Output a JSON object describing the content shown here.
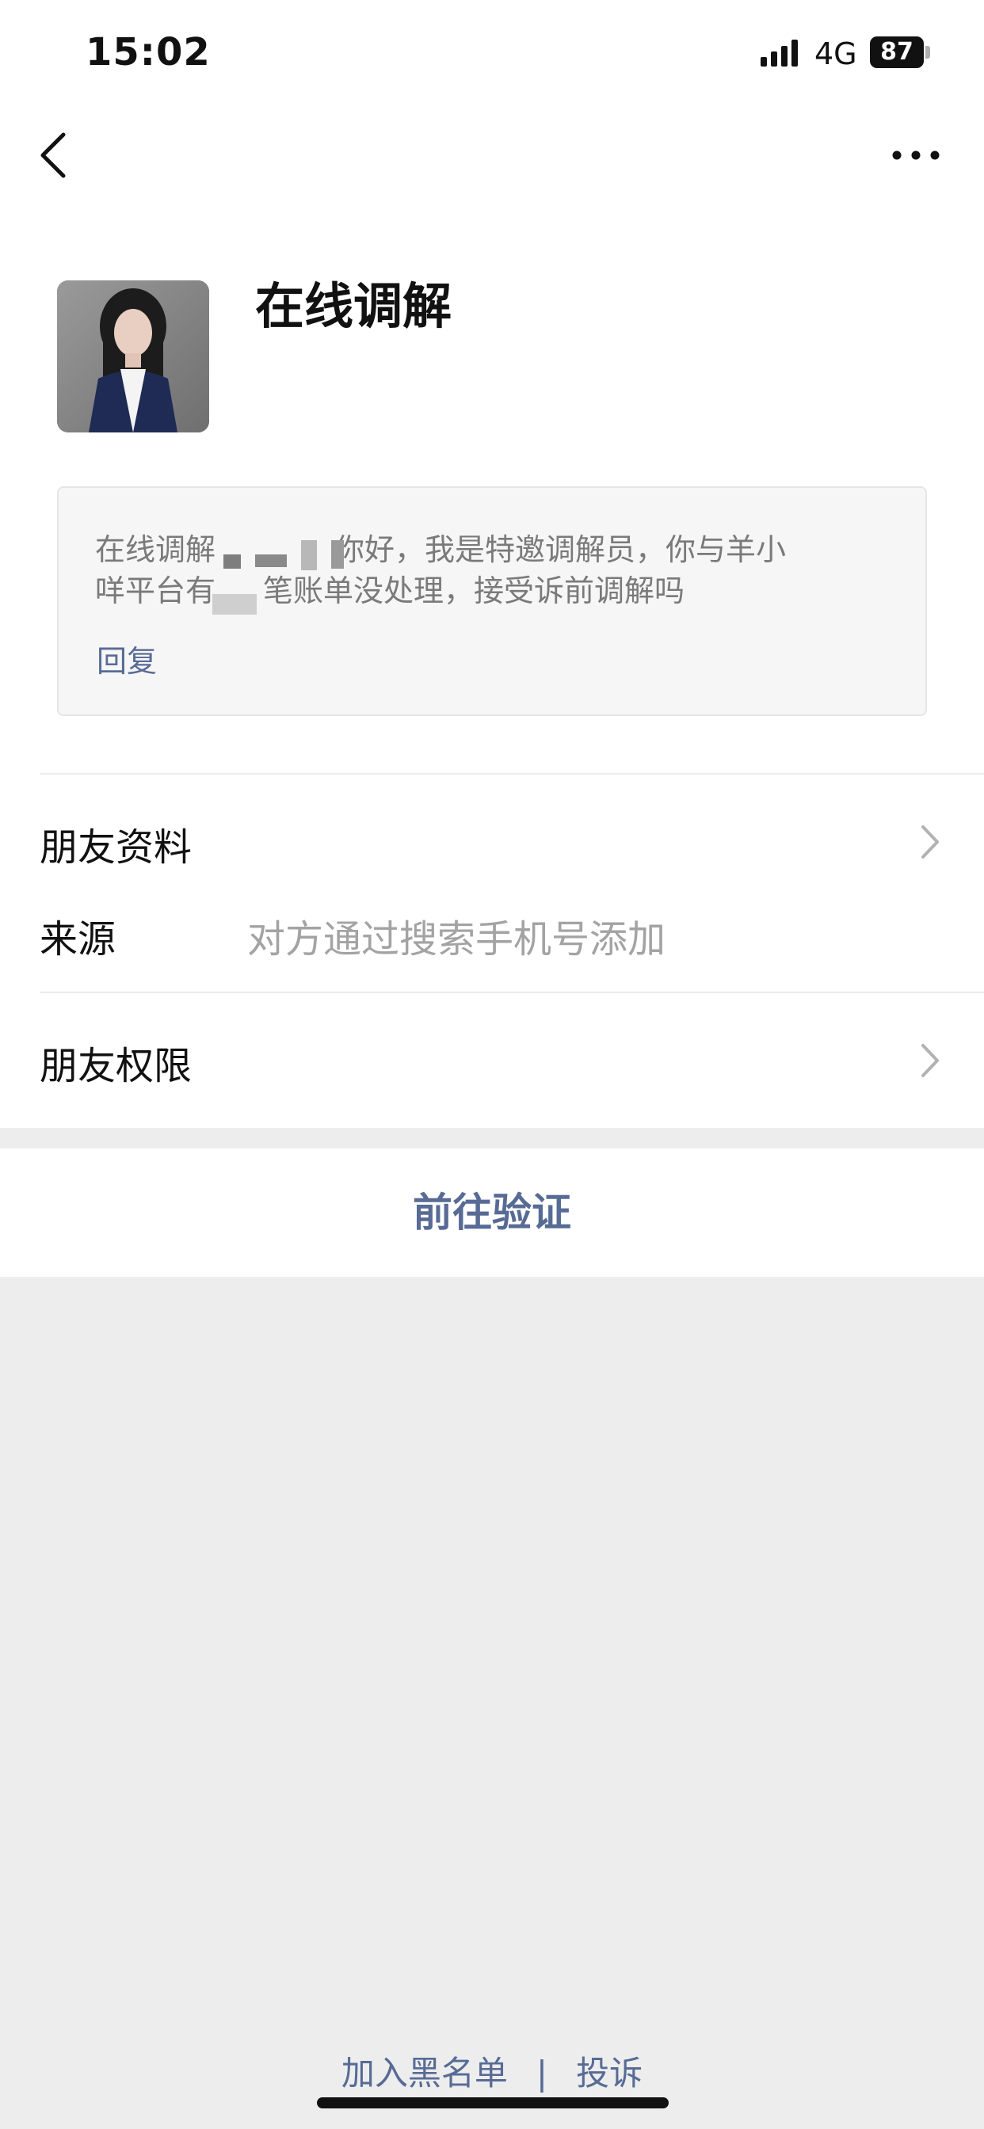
{
  "status_bar": {
    "time": "15:02",
    "network": "4G",
    "battery": "87"
  },
  "nav": {
    "back_icon": "chevron-left-icon",
    "more_icon": "more-horizontal-icon"
  },
  "profile": {
    "name": "在线调解"
  },
  "message": {
    "line1_prefix": "在线调解",
    "line1_suffix": "你好，我是特邀调解员，你与羊小",
    "line2_prefix": "咩平台有",
    "line2_suffix": "笔账单没处理，接受诉前调解吗",
    "reply_label": "回复"
  },
  "rows": {
    "friend_info": "朋友资料",
    "source_label": "来源",
    "source_value": "对方通过搜索手机号添加",
    "friend_permissions": "朋友权限"
  },
  "actions": {
    "verify": "前往验证"
  },
  "footer": {
    "blacklist": "加入黑名单",
    "separator": "|",
    "report": "投诉"
  },
  "colors": {
    "link": "#576b95",
    "background": "#ededed",
    "text": "#111111",
    "secondary_text": "#a3a3a3"
  }
}
